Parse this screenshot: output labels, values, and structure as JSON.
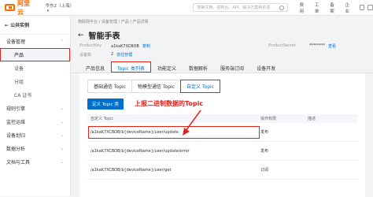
{
  "topbar": {
    "logo_text": "阿里云",
    "region": "华东2（上海）",
    "search_placeholder": "搜索文档、控制台、API、解决方案和资源",
    "nav": [
      "费用",
      "工单",
      "备案",
      "企业"
    ]
  },
  "sidebar": {
    "back_label": "公共实例",
    "items": [
      {
        "label": "设备管理",
        "type": "group"
      },
      {
        "label": "产品",
        "type": "sub",
        "active": true,
        "highlighted": true
      },
      {
        "label": "设备",
        "type": "sub"
      },
      {
        "label": "分组",
        "type": "sub"
      },
      {
        "label": "CA 证书",
        "type": "sub"
      },
      {
        "label": "规则引擎",
        "type": "group"
      },
      {
        "label": "监控运维",
        "type": "group"
      },
      {
        "label": "设备划归",
        "type": "group"
      },
      {
        "label": "数据分析",
        "type": "group"
      },
      {
        "label": "文档与工具",
        "type": "group"
      }
    ]
  },
  "main": {
    "breadcrumb": "物联网平台 / 设备管理 / 产品 / 产品详情",
    "title": "智能手表",
    "product_key_label": "ProductKey",
    "product_key_value": "a1kaK7XCBOB",
    "product_key_action": "复制",
    "product_secret_label": "ProductSecret",
    "product_secret_value": "********",
    "product_secret_action": "查看",
    "device_count_label": "设备数",
    "device_count_value": "2",
    "device_count_action": "前往管理",
    "tabs": [
      "产品信息",
      "Topic 类列表",
      "功能定义",
      "数据解析",
      "服务端订阅",
      "设备开发"
    ],
    "active_tab": 1,
    "subtabs": [
      "基础通信 Topic",
      "物模型通信 Topic",
      "自定义 Topic"
    ],
    "active_subtab": 2,
    "define_button": "定义 Topic 类",
    "table": {
      "headers": [
        "自定义 Topic",
        "操作权限",
        "描述"
      ],
      "rows": [
        {
          "topic": "/a1kaK7XCBOB/${deviceName}/user/update",
          "permission": "发布",
          "desc": "",
          "highlighted": true
        },
        {
          "topic": "/a1kaK7XCBOB/${deviceName}/user/update/error",
          "permission": "发布",
          "desc": ""
        },
        {
          "topic": "/a1kaK7XCBOB/${deviceName}/user/get",
          "permission": "订阅",
          "desc": ""
        }
      ]
    },
    "annotation": "上报二进制数据的Topic"
  },
  "colors": {
    "accent": "#0070cc",
    "brand": "#ff6a00",
    "annotation": "#e2231a"
  }
}
